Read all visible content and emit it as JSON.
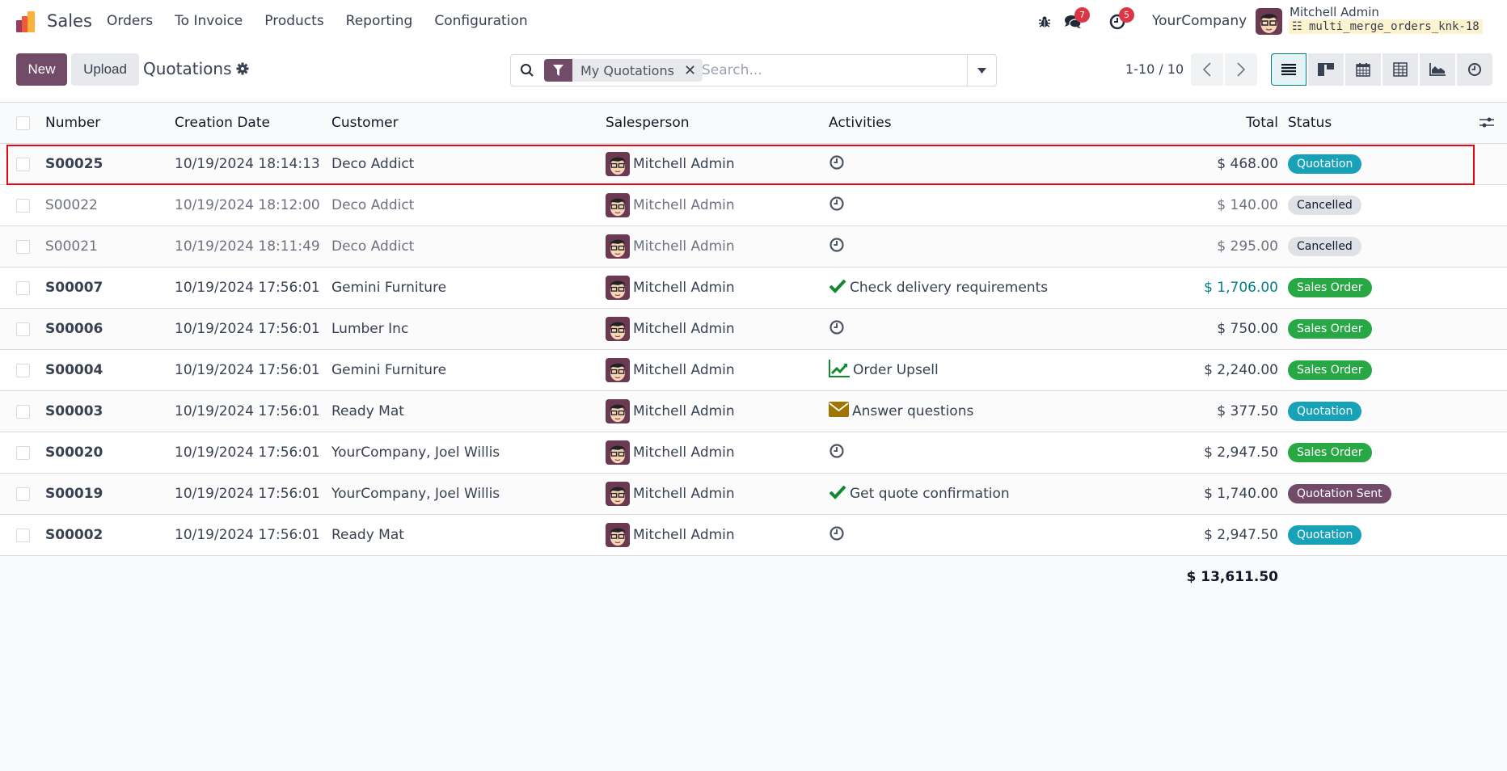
{
  "topnav": {
    "app_name": "Sales",
    "menu": [
      "Orders",
      "To Invoice",
      "Products",
      "Reporting",
      "Configuration"
    ],
    "messages_count": "7",
    "activities_count": "5",
    "company": "YourCompany",
    "user_name": "Mitchell Admin",
    "db_name": "multi_merge_orders_knk-18"
  },
  "control": {
    "new_label": "New",
    "upload_label": "Upload",
    "title": "Quotations",
    "facet_label": "My Quotations",
    "search_placeholder": "Search...",
    "pager": "1-10 / 10",
    "views": [
      "list",
      "kanban",
      "calendar",
      "pivot",
      "graph",
      "activity"
    ],
    "active_view": "list"
  },
  "colors": {
    "brand": "#714b67",
    "quotation": "#17a2b8",
    "cancelled": "#dee2e6",
    "sales_order": "#28a745",
    "quotation_sent": "#714b67",
    "highlight": "#e30613"
  },
  "table": {
    "headers": {
      "number": "Number",
      "date": "Creation Date",
      "customer": "Customer",
      "salesperson": "Salesperson",
      "activities": "Activities",
      "total": "Total",
      "status": "Status"
    },
    "rows": [
      {
        "number": "S00025",
        "date": "10/19/2024 18:14:13",
        "customer": "Deco Addict",
        "salesperson": "Mitchell Admin",
        "activity_icon": "clock-icon",
        "activity": "",
        "total": "$ 468.00",
        "status": "Quotation",
        "status_kind": "quotation",
        "muted": false,
        "highlighted": true
      },
      {
        "number": "S00022",
        "date": "10/19/2024 18:12:00",
        "customer": "Deco Addict",
        "salesperson": "Mitchell Admin",
        "activity_icon": "clock-icon",
        "activity": "",
        "total": "$ 140.00",
        "status": "Cancelled",
        "status_kind": "cancelled",
        "muted": true
      },
      {
        "number": "S00021",
        "date": "10/19/2024 18:11:49",
        "customer": "Deco Addict",
        "salesperson": "Mitchell Admin",
        "activity_icon": "clock-icon",
        "activity": "",
        "total": "$ 295.00",
        "status": "Cancelled",
        "status_kind": "cancelled",
        "muted": true
      },
      {
        "number": "S00007",
        "date": "10/19/2024 17:56:01",
        "customer": "Gemini Furniture",
        "salesperson": "Mitchell Admin",
        "activity_icon": "check-icon",
        "activity": "Check delivery requirements",
        "total": "$ 1,706.00",
        "total_color": "#017e84",
        "status": "Sales Order",
        "status_kind": "sales_order",
        "muted": false
      },
      {
        "number": "S00006",
        "date": "10/19/2024 17:56:01",
        "customer": "Lumber Inc",
        "salesperson": "Mitchell Admin",
        "activity_icon": "clock-icon",
        "activity": "",
        "total": "$ 750.00",
        "status": "Sales Order",
        "status_kind": "sales_order",
        "muted": false
      },
      {
        "number": "S00004",
        "date": "10/19/2024 17:56:01",
        "customer": "Gemini Furniture",
        "salesperson": "Mitchell Admin",
        "activity_icon": "line-chart-icon",
        "activity": "Order Upsell",
        "total": "$ 2,240.00",
        "status": "Sales Order",
        "status_kind": "sales_order",
        "muted": false
      },
      {
        "number": "S00003",
        "date": "10/19/2024 17:56:01",
        "customer": "Ready Mat",
        "salesperson": "Mitchell Admin",
        "activity_icon": "envelope-icon",
        "activity": "Answer questions",
        "total": "$ 377.50",
        "status": "Quotation",
        "status_kind": "quotation",
        "muted": false
      },
      {
        "number": "S00020",
        "date": "10/19/2024 17:56:01",
        "customer": "YourCompany, Joel Willis",
        "salesperson": "Mitchell Admin",
        "activity_icon": "clock-icon",
        "activity": "",
        "total": "$ 2,947.50",
        "status": "Sales Order",
        "status_kind": "sales_order",
        "muted": false
      },
      {
        "number": "S00019",
        "date": "10/19/2024 17:56:01",
        "customer": "YourCompany, Joel Willis",
        "salesperson": "Mitchell Admin",
        "activity_icon": "check-icon",
        "activity": "Get quote confirmation",
        "total": "$ 1,740.00",
        "status": "Quotation Sent",
        "status_kind": "quotation_sent",
        "muted": false
      },
      {
        "number": "S00002",
        "date": "10/19/2024 17:56:01",
        "customer": "Ready Mat",
        "salesperson": "Mitchell Admin",
        "activity_icon": "clock-icon",
        "activity": "",
        "total": "$ 2,947.50",
        "status": "Quotation",
        "status_kind": "quotation",
        "muted": false
      }
    ],
    "grand_total": "$ 13,611.50"
  }
}
